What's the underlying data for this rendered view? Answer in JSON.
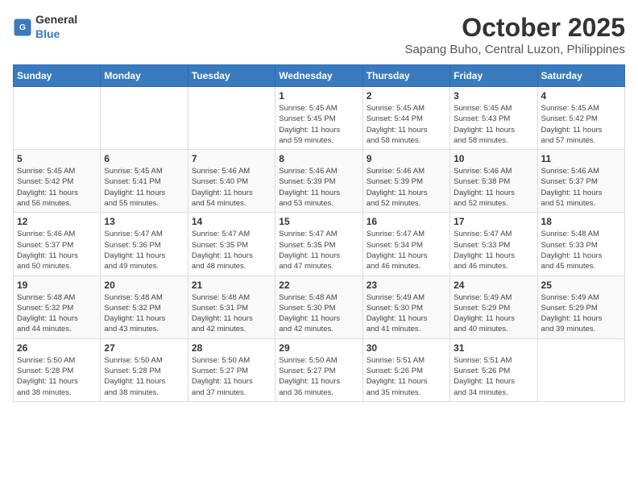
{
  "logo": {
    "text_general": "General",
    "text_blue": "Blue"
  },
  "title": "October 2025",
  "subtitle": "Sapang Buho, Central Luzon, Philippines",
  "weekdays": [
    "Sunday",
    "Monday",
    "Tuesday",
    "Wednesday",
    "Thursday",
    "Friday",
    "Saturday"
  ],
  "weeks": [
    [
      {
        "day": "",
        "info": ""
      },
      {
        "day": "",
        "info": ""
      },
      {
        "day": "",
        "info": ""
      },
      {
        "day": "1",
        "info": "Sunrise: 5:45 AM\nSunset: 5:45 PM\nDaylight: 11 hours\nand 59 minutes."
      },
      {
        "day": "2",
        "info": "Sunrise: 5:45 AM\nSunset: 5:44 PM\nDaylight: 11 hours\nand 58 minutes."
      },
      {
        "day": "3",
        "info": "Sunrise: 5:45 AM\nSunset: 5:43 PM\nDaylight: 11 hours\nand 58 minutes."
      },
      {
        "day": "4",
        "info": "Sunrise: 5:45 AM\nSunset: 5:42 PM\nDaylight: 11 hours\nand 57 minutes."
      }
    ],
    [
      {
        "day": "5",
        "info": "Sunrise: 5:45 AM\nSunset: 5:42 PM\nDaylight: 11 hours\nand 56 minutes."
      },
      {
        "day": "6",
        "info": "Sunrise: 5:45 AM\nSunset: 5:41 PM\nDaylight: 11 hours\nand 55 minutes."
      },
      {
        "day": "7",
        "info": "Sunrise: 5:46 AM\nSunset: 5:40 PM\nDaylight: 11 hours\nand 54 minutes."
      },
      {
        "day": "8",
        "info": "Sunrise: 5:46 AM\nSunset: 5:39 PM\nDaylight: 11 hours\nand 53 minutes."
      },
      {
        "day": "9",
        "info": "Sunrise: 5:46 AM\nSunset: 5:39 PM\nDaylight: 11 hours\nand 52 minutes."
      },
      {
        "day": "10",
        "info": "Sunrise: 5:46 AM\nSunset: 5:38 PM\nDaylight: 11 hours\nand 52 minutes."
      },
      {
        "day": "11",
        "info": "Sunrise: 5:46 AM\nSunset: 5:37 PM\nDaylight: 11 hours\nand 51 minutes."
      }
    ],
    [
      {
        "day": "12",
        "info": "Sunrise: 5:46 AM\nSunset: 5:37 PM\nDaylight: 11 hours\nand 50 minutes."
      },
      {
        "day": "13",
        "info": "Sunrise: 5:47 AM\nSunset: 5:36 PM\nDaylight: 11 hours\nand 49 minutes."
      },
      {
        "day": "14",
        "info": "Sunrise: 5:47 AM\nSunset: 5:35 PM\nDaylight: 11 hours\nand 48 minutes."
      },
      {
        "day": "15",
        "info": "Sunrise: 5:47 AM\nSunset: 5:35 PM\nDaylight: 11 hours\nand 47 minutes."
      },
      {
        "day": "16",
        "info": "Sunrise: 5:47 AM\nSunset: 5:34 PM\nDaylight: 11 hours\nand 46 minutes."
      },
      {
        "day": "17",
        "info": "Sunrise: 5:47 AM\nSunset: 5:33 PM\nDaylight: 11 hours\nand 46 minutes."
      },
      {
        "day": "18",
        "info": "Sunrise: 5:48 AM\nSunset: 5:33 PM\nDaylight: 11 hours\nand 45 minutes."
      }
    ],
    [
      {
        "day": "19",
        "info": "Sunrise: 5:48 AM\nSunset: 5:32 PM\nDaylight: 11 hours\nand 44 minutes."
      },
      {
        "day": "20",
        "info": "Sunrise: 5:48 AM\nSunset: 5:32 PM\nDaylight: 11 hours\nand 43 minutes."
      },
      {
        "day": "21",
        "info": "Sunrise: 5:48 AM\nSunset: 5:31 PM\nDaylight: 11 hours\nand 42 minutes."
      },
      {
        "day": "22",
        "info": "Sunrise: 5:48 AM\nSunset: 5:30 PM\nDaylight: 11 hours\nand 42 minutes."
      },
      {
        "day": "23",
        "info": "Sunrise: 5:49 AM\nSunset: 5:30 PM\nDaylight: 11 hours\nand 41 minutes."
      },
      {
        "day": "24",
        "info": "Sunrise: 5:49 AM\nSunset: 5:29 PM\nDaylight: 11 hours\nand 40 minutes."
      },
      {
        "day": "25",
        "info": "Sunrise: 5:49 AM\nSunset: 5:29 PM\nDaylight: 11 hours\nand 39 minutes."
      }
    ],
    [
      {
        "day": "26",
        "info": "Sunrise: 5:50 AM\nSunset: 5:28 PM\nDaylight: 11 hours\nand 38 minutes."
      },
      {
        "day": "27",
        "info": "Sunrise: 5:50 AM\nSunset: 5:28 PM\nDaylight: 11 hours\nand 38 minutes."
      },
      {
        "day": "28",
        "info": "Sunrise: 5:50 AM\nSunset: 5:27 PM\nDaylight: 11 hours\nand 37 minutes."
      },
      {
        "day": "29",
        "info": "Sunrise: 5:50 AM\nSunset: 5:27 PM\nDaylight: 11 hours\nand 36 minutes."
      },
      {
        "day": "30",
        "info": "Sunrise: 5:51 AM\nSunset: 5:26 PM\nDaylight: 11 hours\nand 35 minutes."
      },
      {
        "day": "31",
        "info": "Sunrise: 5:51 AM\nSunset: 5:26 PM\nDaylight: 11 hours\nand 34 minutes."
      },
      {
        "day": "",
        "info": ""
      }
    ]
  ]
}
